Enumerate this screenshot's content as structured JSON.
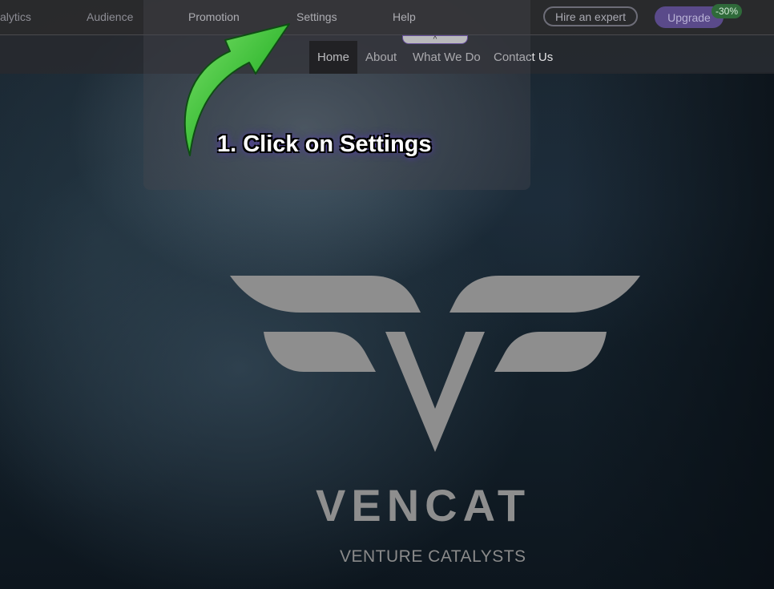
{
  "editor_bar": {
    "tabs": [
      "alytics",
      "Audience",
      "Promotion",
      "Settings",
      "Help"
    ],
    "hire_label": "Hire an expert",
    "upgrade_label": "Upgrade",
    "discount_badge": "-30%"
  },
  "site_nav": {
    "links": [
      "Home",
      "About",
      "What We Do",
      "Contact Us"
    ],
    "handle_glyph": "^"
  },
  "tutorial": {
    "instruction": "1. Click on Settings",
    "arrow_color": "#3fbf3a"
  },
  "hero": {
    "brand": "VENCAT",
    "tagline": "VENTURE CATALYSTS",
    "logo_color": "#8e8e8e"
  },
  "icons": {
    "arrow": "curved-arrow-icon",
    "handle": "chevron-up-icon",
    "logo": "vencat-logo-icon"
  }
}
